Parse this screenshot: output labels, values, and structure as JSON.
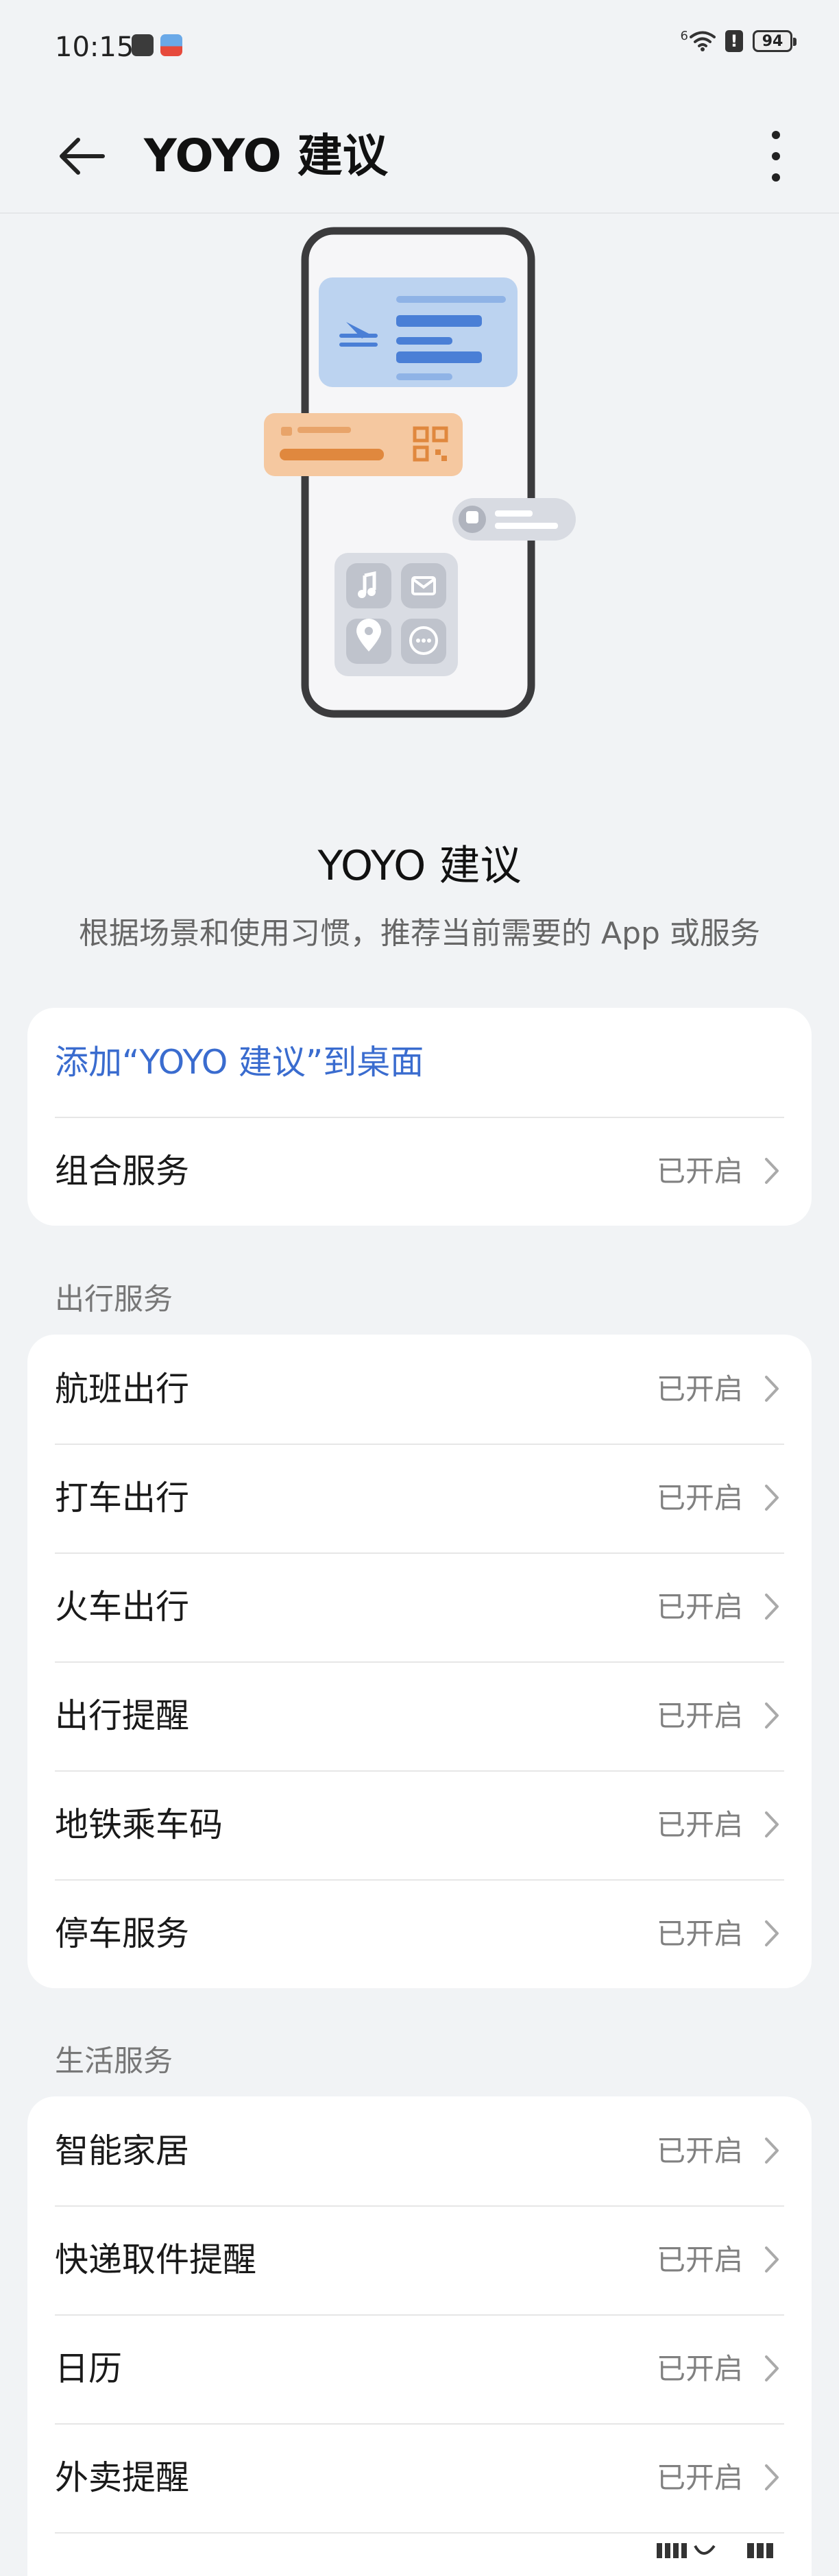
{
  "status_bar": {
    "time": "10:15",
    "battery": "94",
    "network_sup": "6",
    "alert": "!"
  },
  "app_bar": {
    "title": "YOYO 建议"
  },
  "intro": {
    "title": "YOYO 建议",
    "description": "根据场景和使用习惯，推荐当前需要的 App 或服务"
  },
  "top_card": {
    "add_to_desktop": "添加“YOYO 建议”到桌面",
    "items": [
      {
        "label": "组合服务",
        "status": "已开启"
      }
    ]
  },
  "travel": {
    "title": "出行服务",
    "items": [
      {
        "label": "航班出行",
        "status": "已开启"
      },
      {
        "label": "打车出行",
        "status": "已开启"
      },
      {
        "label": "火车出行",
        "status": "已开启"
      },
      {
        "label": "出行提醒",
        "status": "已开启"
      },
      {
        "label": "地铁乘车码",
        "status": "已开启"
      },
      {
        "label": "停车服务",
        "status": "已开启"
      }
    ]
  },
  "life": {
    "title": "生活服务",
    "items": [
      {
        "label": "智能家居",
        "status": "已开启"
      },
      {
        "label": "快递取件提醒",
        "status": "已开启"
      },
      {
        "label": "日历",
        "status": "已开启"
      },
      {
        "label": "外卖提醒",
        "status": "已开启"
      }
    ]
  },
  "colors": {
    "background": "#f1f3f5",
    "card": "#ffffff",
    "link": "#3a6ccf",
    "status_text": "#808080"
  },
  "icons": [
    "back-arrow-icon",
    "more-vertical-icon",
    "chevron-right-icon",
    "wifi-icon",
    "battery-icon"
  ]
}
